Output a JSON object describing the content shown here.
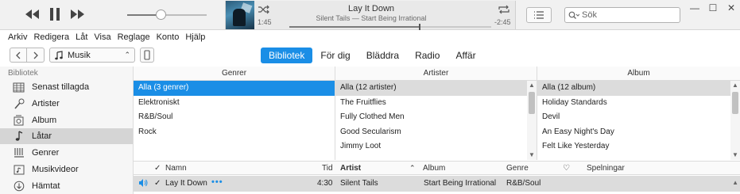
{
  "player": {
    "now_playing": {
      "title": "Lay It Down",
      "subtitle": "Silent Tails — Start Being Irrational",
      "elapsed": "1:45",
      "remaining": "-2:45",
      "progress": 0.64
    },
    "volume": 0.42,
    "search_placeholder": "Sök"
  },
  "menu": [
    "Arkiv",
    "Redigera",
    "Låt",
    "Visa",
    "Reglage",
    "Konto",
    "Hjälp"
  ],
  "media_selector": "Musik",
  "tabs": [
    {
      "label": "Bibliotek",
      "active": true
    },
    {
      "label": "För dig",
      "active": false
    },
    {
      "label": "Bläddra",
      "active": false
    },
    {
      "label": "Radio",
      "active": false
    },
    {
      "label": "Affär",
      "active": false
    }
  ],
  "sidebar": {
    "heading": "Bibliotek",
    "items": [
      {
        "label": "Senast tillagda",
        "icon": "recently-added-icon"
      },
      {
        "label": "Artister",
        "icon": "microphone-icon"
      },
      {
        "label": "Album",
        "icon": "album-icon"
      },
      {
        "label": "Låtar",
        "icon": "music-note-icon",
        "selected": true
      },
      {
        "label": "Genrer",
        "icon": "genres-icon"
      },
      {
        "label": "Musikvideor",
        "icon": "music-video-icon"
      },
      {
        "label": "Hämtat",
        "icon": "download-icon"
      }
    ]
  },
  "columns": {
    "genres": {
      "header": "Genrer",
      "items": [
        "Alla (3 genrer)",
        "Elektroniskt",
        "R&B/Soul",
        "Rock"
      ]
    },
    "artists": {
      "header": "Artister",
      "items": [
        "Alla (12 artister)",
        "The Fruitflies",
        "Fully Clothed Men",
        "Good Secularism",
        "Jimmy Loot"
      ]
    },
    "albums": {
      "header": "Album",
      "items": [
        "Alla (12 album)",
        "Holiday Standards",
        "Devil",
        "An Easy Night's Day",
        "Felt Like Yesterday"
      ]
    }
  },
  "songlist": {
    "headers": {
      "check": "✓",
      "name": "Namn",
      "time": "Tid",
      "artist": "Artist",
      "album": "Album",
      "genre": "Genre",
      "love": "♡",
      "plays": "Spelningar"
    },
    "rows": [
      {
        "check": "✓",
        "name": "Lay It Down",
        "more": "•••",
        "time": "4:30",
        "artist": "Silent Tails",
        "album": "Start Being Irrational",
        "genre": "R&B/Soul"
      }
    ]
  },
  "colors": {
    "accent": "#1a8ee6",
    "selection_grey": "#dcdcdc",
    "sidebar_bg": "#f6f6f6"
  }
}
